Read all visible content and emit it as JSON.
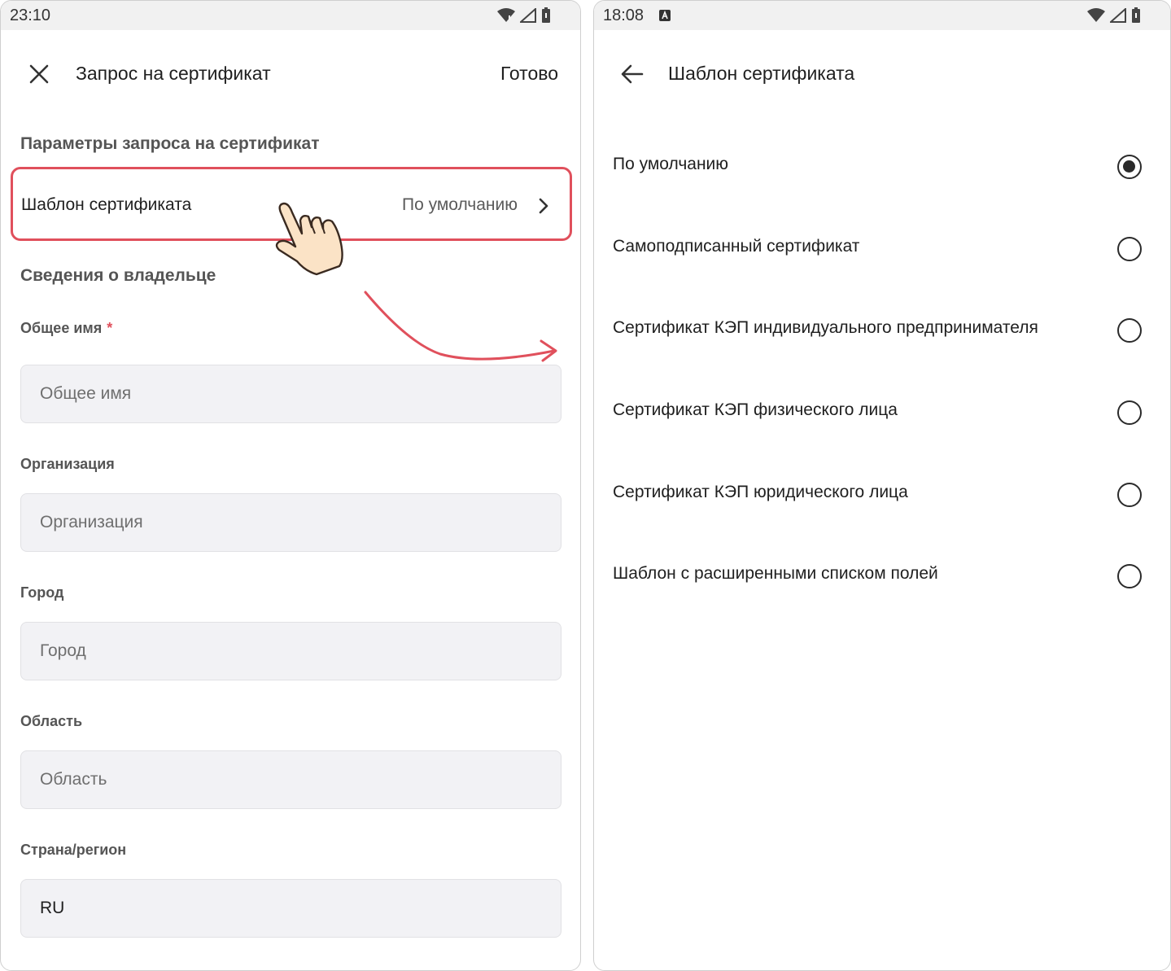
{
  "left_screen": {
    "status_time": "23:10",
    "title": "Запрос на сертификат",
    "done_label": "Готово",
    "section_request": "Параметры запроса на сертификат",
    "template_row": {
      "label": "Шаблон сертификата",
      "value": "По умолчанию"
    },
    "section_owner": "Сведения о владельце",
    "fields": [
      {
        "label": "Общее имя",
        "required": true,
        "required_mark": "*",
        "placeholder": "Общее имя",
        "value": ""
      },
      {
        "label": "Организация",
        "required": false,
        "placeholder": "Организация",
        "value": ""
      },
      {
        "label": "Город",
        "required": false,
        "placeholder": "Город",
        "value": ""
      },
      {
        "label": "Область",
        "required": false,
        "placeholder": "Область",
        "value": ""
      },
      {
        "label": "Страна/регион",
        "required": false,
        "placeholder": "",
        "value": "RU"
      }
    ]
  },
  "right_screen": {
    "status_time": "18:08",
    "title": "Шаблон сертификата",
    "options": [
      {
        "label": "По умолчанию",
        "selected": true
      },
      {
        "label": "Самоподписанный сертификат",
        "selected": false
      },
      {
        "label": "Сертификат КЭП индивидуального предпринимателя",
        "selected": false
      },
      {
        "label": "Сертификат КЭП физического лица",
        "selected": false
      },
      {
        "label": "Сертификат КЭП юридического лица",
        "selected": false
      },
      {
        "label": "Шаблон с расширенными списком полей",
        "selected": false
      }
    ]
  },
  "colors": {
    "highlight": "#e0505c",
    "field_background": "#f2f2f5",
    "status_bar": "#f1f1f1",
    "hand_fill": "#fbe3c6"
  },
  "icons": {
    "close": "close-icon",
    "back": "arrow-back-icon",
    "chevron": "chevron-right-icon",
    "wifi": "wifi-icon",
    "signal": "signal-icon",
    "battery": "battery-icon",
    "keyboard_notification": "keyboard-a-icon",
    "annotation_hand": "hand-pointer-icon",
    "annotation_arrow": "curved-arrow-icon"
  }
}
